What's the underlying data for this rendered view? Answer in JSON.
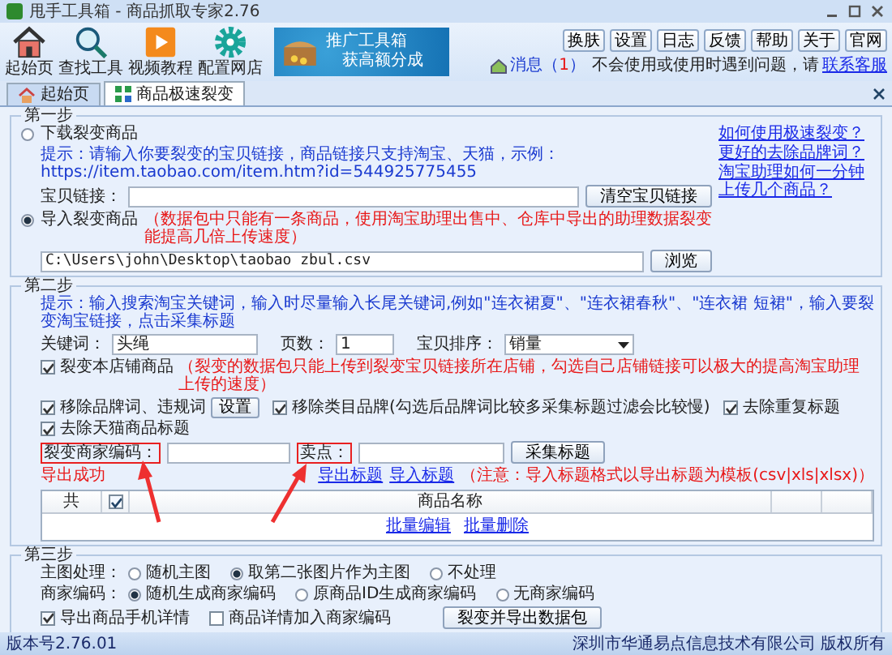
{
  "window": {
    "title": "甩手工具箱 - 商品抓取专家2.76"
  },
  "toolbar": [
    {
      "label": "起始页"
    },
    {
      "label": "查找工具"
    },
    {
      "label": "视频教程"
    },
    {
      "label": "配置网店"
    }
  ],
  "banner": {
    "line_1": "推广工具箱",
    "line_2": "获高额分成"
  },
  "top_buttons": [
    "换肤",
    "设置",
    "日志",
    "反馈",
    "帮助",
    "关于",
    "官网"
  ],
  "messages": {
    "label": "消息（",
    "count": "1",
    "close": "）"
  },
  "help_text": "不会使用或使用时遇到问题，请",
  "help_link": "联系客服",
  "tabs": [
    {
      "label": "起始页",
      "selected": false
    },
    {
      "label": "商品极速裂变",
      "selected": true
    }
  ],
  "step1": {
    "title": "第一步",
    "options": [
      {
        "label": "下载裂变商品",
        "selected": false
      },
      {
        "label": "导入裂变商品",
        "selected": true
      }
    ],
    "hint": "提示：请输入你要裂变的宝贝链接，商品链接只支持淘宝、天猫，示例：https://item.taobao.com/item.htm?id=544925775455",
    "link_label": "宝贝链接：",
    "clear_button": "清空宝贝链接",
    "import_note": "（数据包中只能有一条商品，使用淘宝助理出售中、仓库中导出的助理数据裂变能提高几倍上传速度）",
    "file_path": "C:\\Users\\john\\Desktop\\taobao zbul.csv",
    "browse_button": "浏览",
    "help_links": [
      "如何使用极速裂变？",
      "更好的去除品牌词？",
      "淘宝助理如何一分钟上传几个商品？"
    ]
  },
  "step2": {
    "title": "第二步",
    "hint": "提示：输入搜索淘宝关键词，输入时尽量输入长尾关键词,例如\"连衣裙夏\"、\"连衣裙春秋\"、\"连衣裙 短裙\"，输入要裂变淘宝链接，点击采集标题",
    "keyword_label": "关键词：",
    "keyword": "头绳",
    "pages_label": "页数：",
    "pages": "1",
    "sort_label": "宝贝排序：",
    "sort": "销量",
    "shop_check": {
      "label": "裂变本店铺商品",
      "checked": true,
      "note": "（裂变的数据包只能上传到裂变宝贝链接所在店铺，勾选自己店铺链接可以极大的提高淘宝助理上传的速度）"
    },
    "filters": [
      {
        "label": "移除品牌词、违规词",
        "checked": true,
        "kind": "with_button"
      },
      {
        "label": "移除类目品牌(勾选后品牌词比较多采集标题过滤会比较慢)",
        "checked": true,
        "kind": "plain"
      },
      {
        "label": "去除重复标题",
        "checked": true,
        "kind": "plain"
      },
      {
        "label": "去除天猫商品标题",
        "checked": true,
        "kind": "plain"
      }
    ],
    "settings_button": "设置",
    "merchant_code_label": "裂变商家编码：",
    "merchant_code_highlighted": true,
    "selling_point_label": "卖点：",
    "selling_point_highlighted": true,
    "status": "导出成功",
    "collect_button": "采集标题",
    "export_link": "导出标题",
    "import_link": "导入标题",
    "export_note": "（注意：导入标题格式以导出标题为模板(csv|xls|xlsx)）",
    "table": {
      "columns": [
        "共",
        "商品名称"
      ],
      "header_checked": true,
      "actions": [
        "批量编辑",
        "批量删除"
      ]
    }
  },
  "step3": {
    "title": "第三步",
    "image_label": "主图处理：",
    "image_options": [
      {
        "label": "随机主图",
        "selected": false
      },
      {
        "label": "取第二张图片作为主图",
        "selected": true
      },
      {
        "label": "不处理",
        "selected": false
      }
    ],
    "code_label": "商家编码：",
    "code_options": [
      {
        "label": "随机生成商家编码",
        "selected": true
      },
      {
        "label": "原商品ID生成商家编码",
        "selected": false
      },
      {
        "label": "无商家编码",
        "selected": false
      }
    ],
    "checks": [
      {
        "label": "导出商品手机详情",
        "checked": true
      },
      {
        "label": "商品详情加入商家编码",
        "checked": false
      }
    ],
    "run_button": "裂变并导出数据包"
  },
  "status_bar": {
    "version": "版本号2.76.01",
    "copyright": "深圳市华通易点信息技术有限公司 版权所有"
  }
}
